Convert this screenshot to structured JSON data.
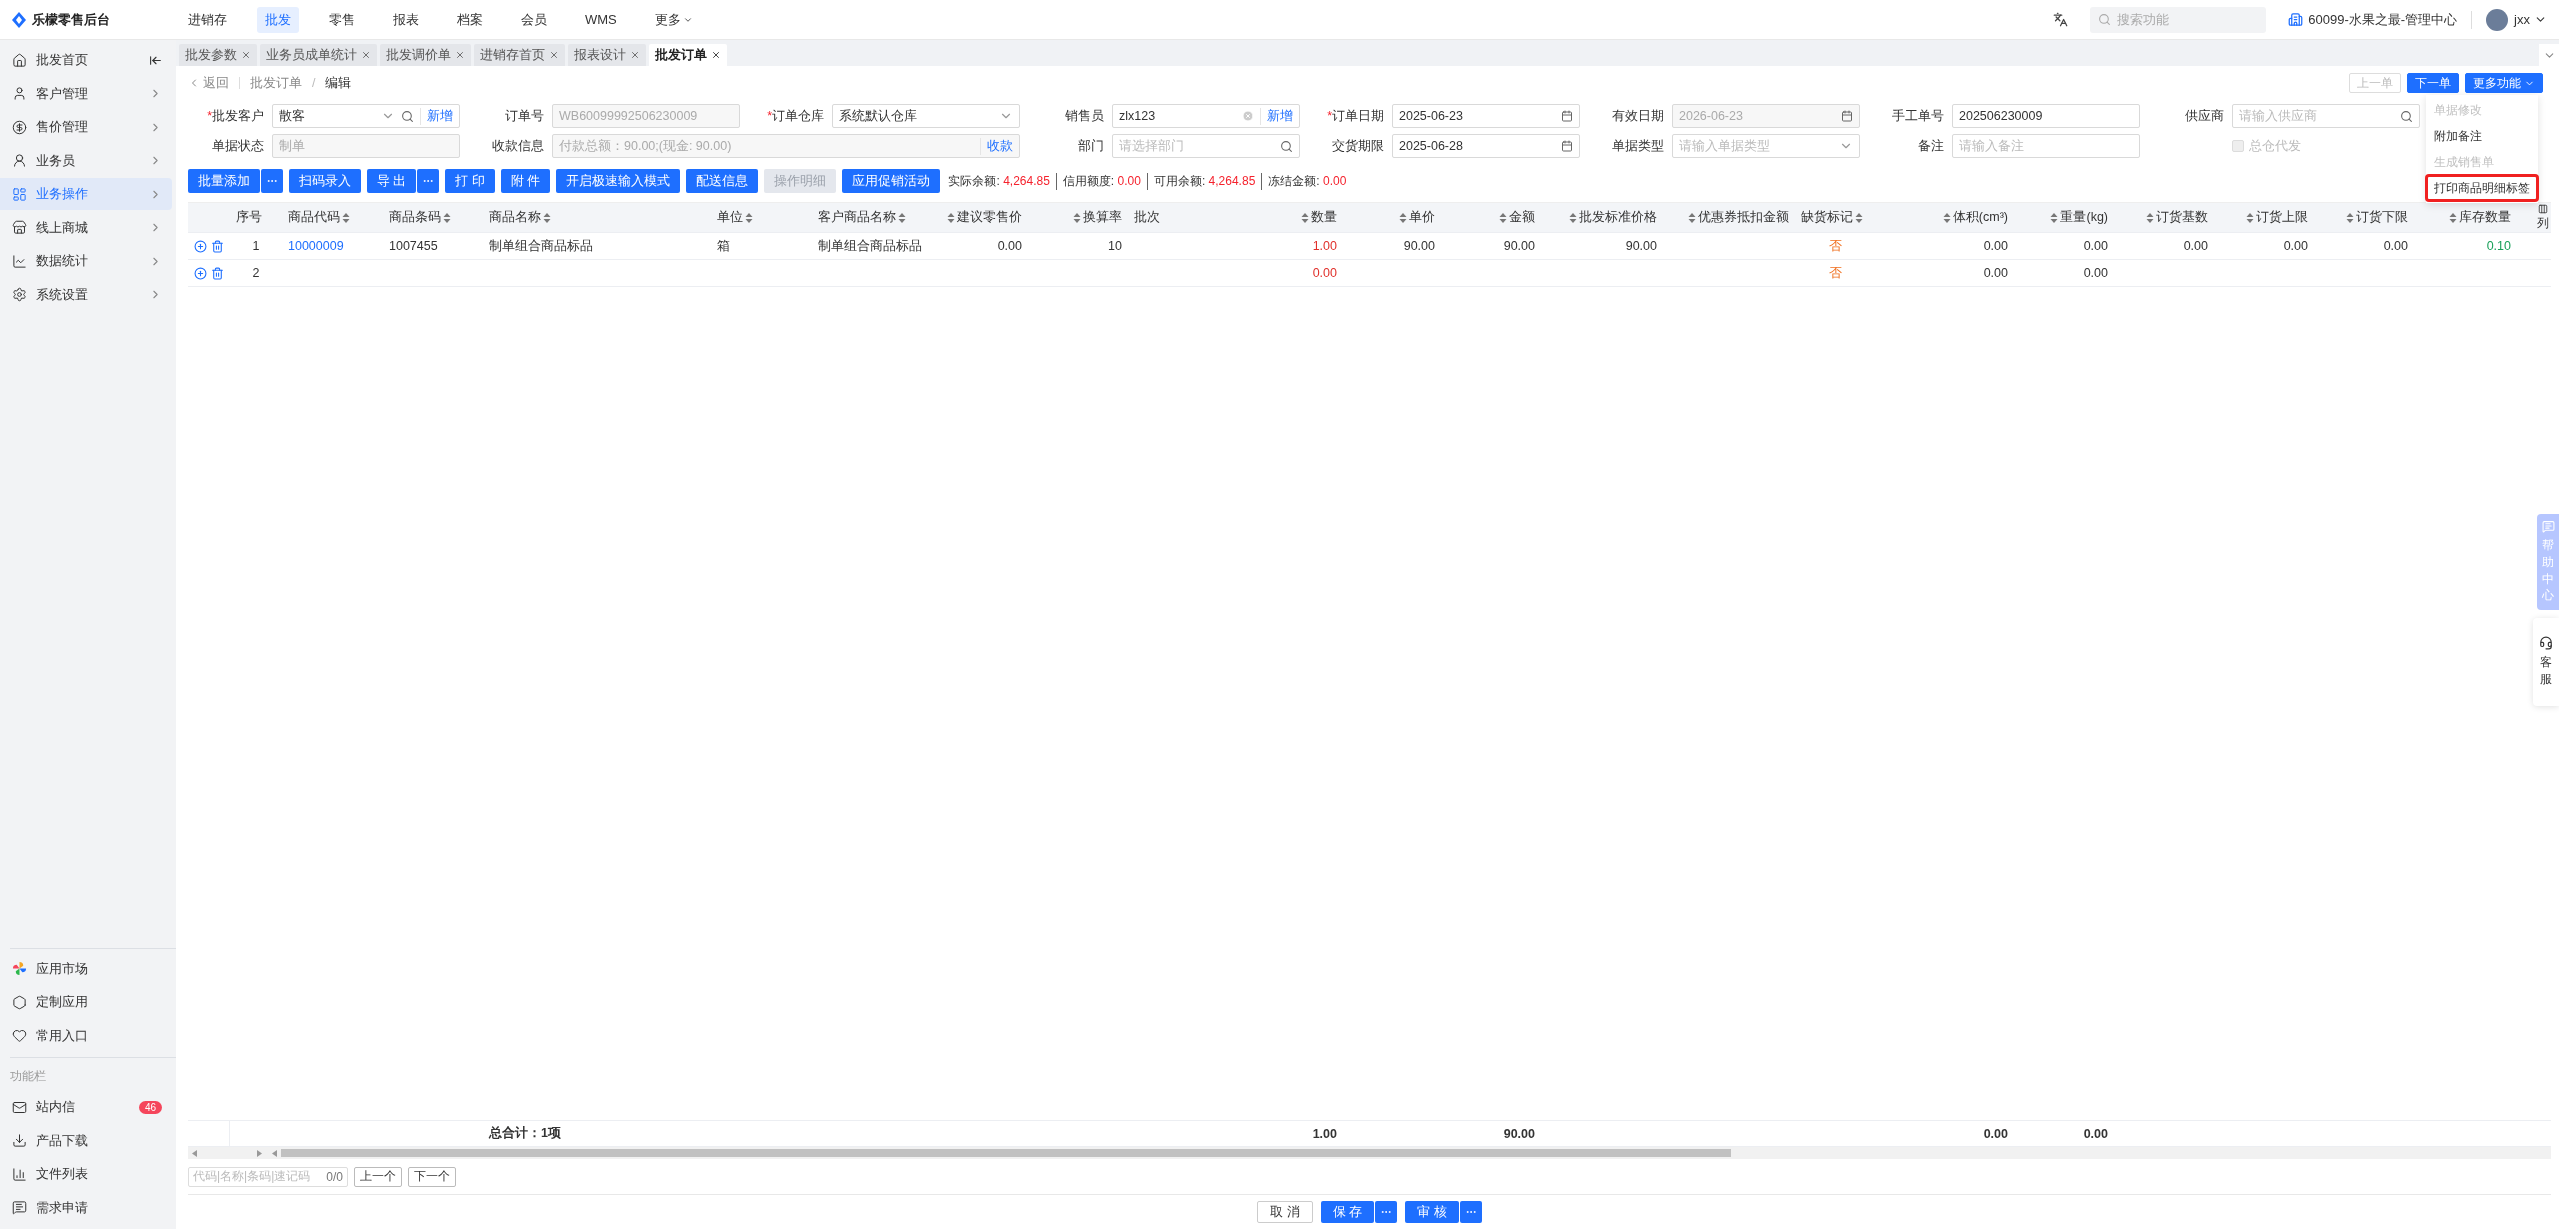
{
  "app": {
    "logo_text": "乐檬零售后台"
  },
  "top_nav": [
    {
      "label": "进销存",
      "selected": false
    },
    {
      "label": "批发",
      "selected": true
    },
    {
      "label": "零售",
      "selected": false
    },
    {
      "label": "报表",
      "selected": false
    },
    {
      "label": "档案",
      "selected": false
    },
    {
      "label": "会员",
      "selected": false
    },
    {
      "label": "WMS",
      "selected": false
    },
    {
      "label": "更多",
      "selected": false,
      "has_menu": true
    }
  ],
  "top_right": {
    "search_placeholder": "搜索功能",
    "store": "60099-水果之最-管理中心",
    "user": "jxx"
  },
  "sidebar": {
    "items": [
      {
        "label": "批发首页",
        "selected": false
      },
      {
        "label": "客户管理",
        "selected": false
      },
      {
        "label": "售价管理",
        "selected": false
      },
      {
        "label": "业务员",
        "selected": false
      },
      {
        "label": "业务操作",
        "selected": true
      },
      {
        "label": "线上商城",
        "selected": false
      },
      {
        "label": "数据统计",
        "selected": false
      },
      {
        "label": "系统设置",
        "selected": false
      }
    ],
    "bottom_items": [
      {
        "label": "应用市场"
      },
      {
        "label": "定制应用"
      },
      {
        "label": "常用入口"
      }
    ],
    "section_title": "功能栏",
    "tool_items": [
      {
        "label": "站内信",
        "badge": "46"
      },
      {
        "label": "产品下载"
      },
      {
        "label": "文件列表"
      },
      {
        "label": "需求申请"
      }
    ]
  },
  "tabs": [
    {
      "label": "批发参数",
      "selected": false
    },
    {
      "label": "业务员成单统计",
      "selected": false
    },
    {
      "label": "批发调价单",
      "selected": false
    },
    {
      "label": "进销存首页",
      "selected": false
    },
    {
      "label": "报表设计",
      "selected": false
    },
    {
      "label": "批发订单",
      "selected": true
    }
  ],
  "header": {
    "back": "返回",
    "breadcrumb": [
      "批发订单",
      "编辑"
    ],
    "separator": "/",
    "buttons": [
      {
        "label": "上一单",
        "disabled": true,
        "kind": "plain"
      },
      {
        "label": "下一单",
        "disabled": false,
        "kind": "primary"
      },
      {
        "label": "更多功能",
        "disabled": false,
        "kind": "menu"
      }
    ]
  },
  "more_menu": {
    "items": [
      {
        "label": "单据修改",
        "disabled": true,
        "highlighted": false
      },
      {
        "label": "附加备注",
        "disabled": false,
        "highlighted": false
      },
      {
        "label": "生成销售单",
        "disabled": true,
        "highlighted": false
      },
      {
        "label": "打印商品明细标签",
        "disabled": false,
        "highlighted": true
      }
    ]
  },
  "form": {
    "fields": [
      {
        "label": "批发客户",
        "mark": "*",
        "kind": "select-search",
        "value": "散客",
        "disabled": false,
        "action": "新增"
      },
      {
        "label": "订单号",
        "kind": "text",
        "value": "WB60099992506230009",
        "disabled": true
      },
      {
        "label": "订单仓库",
        "mark": "*",
        "kind": "select",
        "value": "系统默认仓库",
        "disabled": false
      },
      {
        "label": "销售员",
        "kind": "clearable",
        "value": "zlx123",
        "disabled": false,
        "action": "新增"
      },
      {
        "label": "订单日期",
        "mark": "*",
        "kind": "date",
        "value": "2025-06-23",
        "disabled": false
      },
      {
        "label": "有效日期",
        "kind": "date",
        "value": "2026-06-23",
        "disabled": true
      },
      {
        "label": "手工单号",
        "kind": "text",
        "value": "202506230009",
        "disabled": false
      },
      {
        "label": "供应商",
        "kind": "search",
        "placeholder": "请输入供应商",
        "disabled": false
      },
      {
        "label": "单据状态",
        "kind": "text",
        "value": "制单",
        "disabled": true
      },
      {
        "label": "收款信息",
        "kind": "text",
        "value": "付款总额：90.00;(现金: 90.00)",
        "disabled": true,
        "action": "收款",
        "wide": true
      },
      {
        "label": "部门",
        "kind": "search",
        "placeholder": "请选择部门",
        "disabled": false
      },
      {
        "label": "交货期限",
        "kind": "date",
        "value": "2025-06-28",
        "disabled": false
      },
      {
        "label": "单据类型",
        "kind": "select",
        "placeholder": "请输入单据类型",
        "disabled": false
      },
      {
        "label": "备注",
        "kind": "text",
        "placeholder": "请输入备注",
        "disabled": false
      },
      {
        "label": "总仓代发",
        "kind": "checkbox",
        "checked": false,
        "disabled": true
      }
    ]
  },
  "toolbar": {
    "buttons": [
      {
        "label": "批量添加",
        "more": true,
        "disabled": false
      },
      {
        "label": "扫码录入",
        "more": false,
        "disabled": false
      },
      {
        "label": "导 出",
        "more": true,
        "disabled": false
      },
      {
        "label": "打 印",
        "more": false,
        "disabled": false
      },
      {
        "label": "附 件",
        "more": false,
        "disabled": false
      },
      {
        "label": "开启极速输入模式",
        "more": false,
        "disabled": false
      },
      {
        "label": "配送信息",
        "more": false,
        "disabled": false
      },
      {
        "label": "操作明细",
        "more": false,
        "disabled": true
      },
      {
        "label": "应用促销活动",
        "more": false,
        "disabled": false
      }
    ],
    "balances": [
      {
        "label": "实际余额:",
        "value": "4,264.85"
      },
      {
        "label": "信用额度:",
        "value": "0.00"
      },
      {
        "label": "可用余额:",
        "value": "4,264.85"
      },
      {
        "label": "冻结金额:",
        "value": "0.00"
      }
    ]
  },
  "table": {
    "columns": [
      {
        "label": "序号",
        "kind": "index",
        "sortable": false
      },
      {
        "label": "商品代码",
        "kind": "link",
        "sortable": true
      },
      {
        "label": "商品条码",
        "kind": "text",
        "sortable": true
      },
      {
        "label": "商品名称",
        "kind": "text",
        "sortable": true
      },
      {
        "label": "单位",
        "kind": "text",
        "sortable": true
      },
      {
        "label": "客户商品名称",
        "kind": "text",
        "sortable": true
      },
      {
        "label": "建议零售价",
        "kind": "number",
        "sortable": true
      },
      {
        "label": "换算率",
        "kind": "number",
        "sortable": true
      },
      {
        "label": "批次",
        "kind": "text",
        "sortable": false
      },
      {
        "label": "数量",
        "kind": "qty",
        "sortable": true
      },
      {
        "label": "单价",
        "kind": "number",
        "sortable": true
      },
      {
        "label": "金额",
        "kind": "number",
        "sortable": true
      },
      {
        "label": "批发标准价格",
        "kind": "number",
        "sortable": true
      },
      {
        "label": "优惠券抵扣金额",
        "kind": "number",
        "sortable": true
      },
      {
        "label": "缺货标记",
        "kind": "flag",
        "sortable": true
      },
      {
        "label": "体积(cm³)",
        "kind": "number",
        "sortable": true
      },
      {
        "label": "重量(kg)",
        "kind": "number",
        "sortable": true
      },
      {
        "label": "订货基数",
        "kind": "number",
        "sortable": true
      },
      {
        "label": "订货上限",
        "kind": "number",
        "sortable": true
      },
      {
        "label": "订货下限",
        "kind": "number",
        "sortable": true
      },
      {
        "label": "库存数量",
        "kind": "stock",
        "sortable": true
      }
    ],
    "column_settings": "列",
    "rows": [
      {
        "no": "1",
        "code": "10000009",
        "barcode": "1007455",
        "name": "制单组合商品标品",
        "unit": "箱",
        "customer_name": "制单组合商品标品",
        "retail_price": "0.00",
        "rate": "10",
        "quantity": "1.00",
        "unit_price": "90.00",
        "amount": "90.00",
        "wholesale_price": "90.00",
        "out_of_stock": "否",
        "volume": "0.00",
        "weight": "0.00",
        "order_base": "0.00",
        "order_max": "0.00",
        "order_min": "0.00",
        "stock": "0.10"
      },
      {
        "no": "2",
        "quantity": "0.00",
        "out_of_stock": "否",
        "volume": "0.00",
        "weight": "0.00"
      }
    ],
    "totals": {
      "label": "总合计：1项",
      "quantity": "1.00",
      "amount": "90.00",
      "volume": "0.00",
      "weight": "0.00"
    }
  },
  "locate": {
    "placeholder": "代码|名称|条码|速记码",
    "count": "0/0",
    "buttons": [
      "上一个",
      "下一个"
    ]
  },
  "footer_buttons": [
    {
      "label": "取 消",
      "kind": "plain"
    },
    {
      "label": "保 存",
      "kind": "split"
    },
    {
      "label": "审 核",
      "kind": "split"
    }
  ],
  "float_panel": {
    "help": "帮助中心",
    "service": "客服"
  }
}
